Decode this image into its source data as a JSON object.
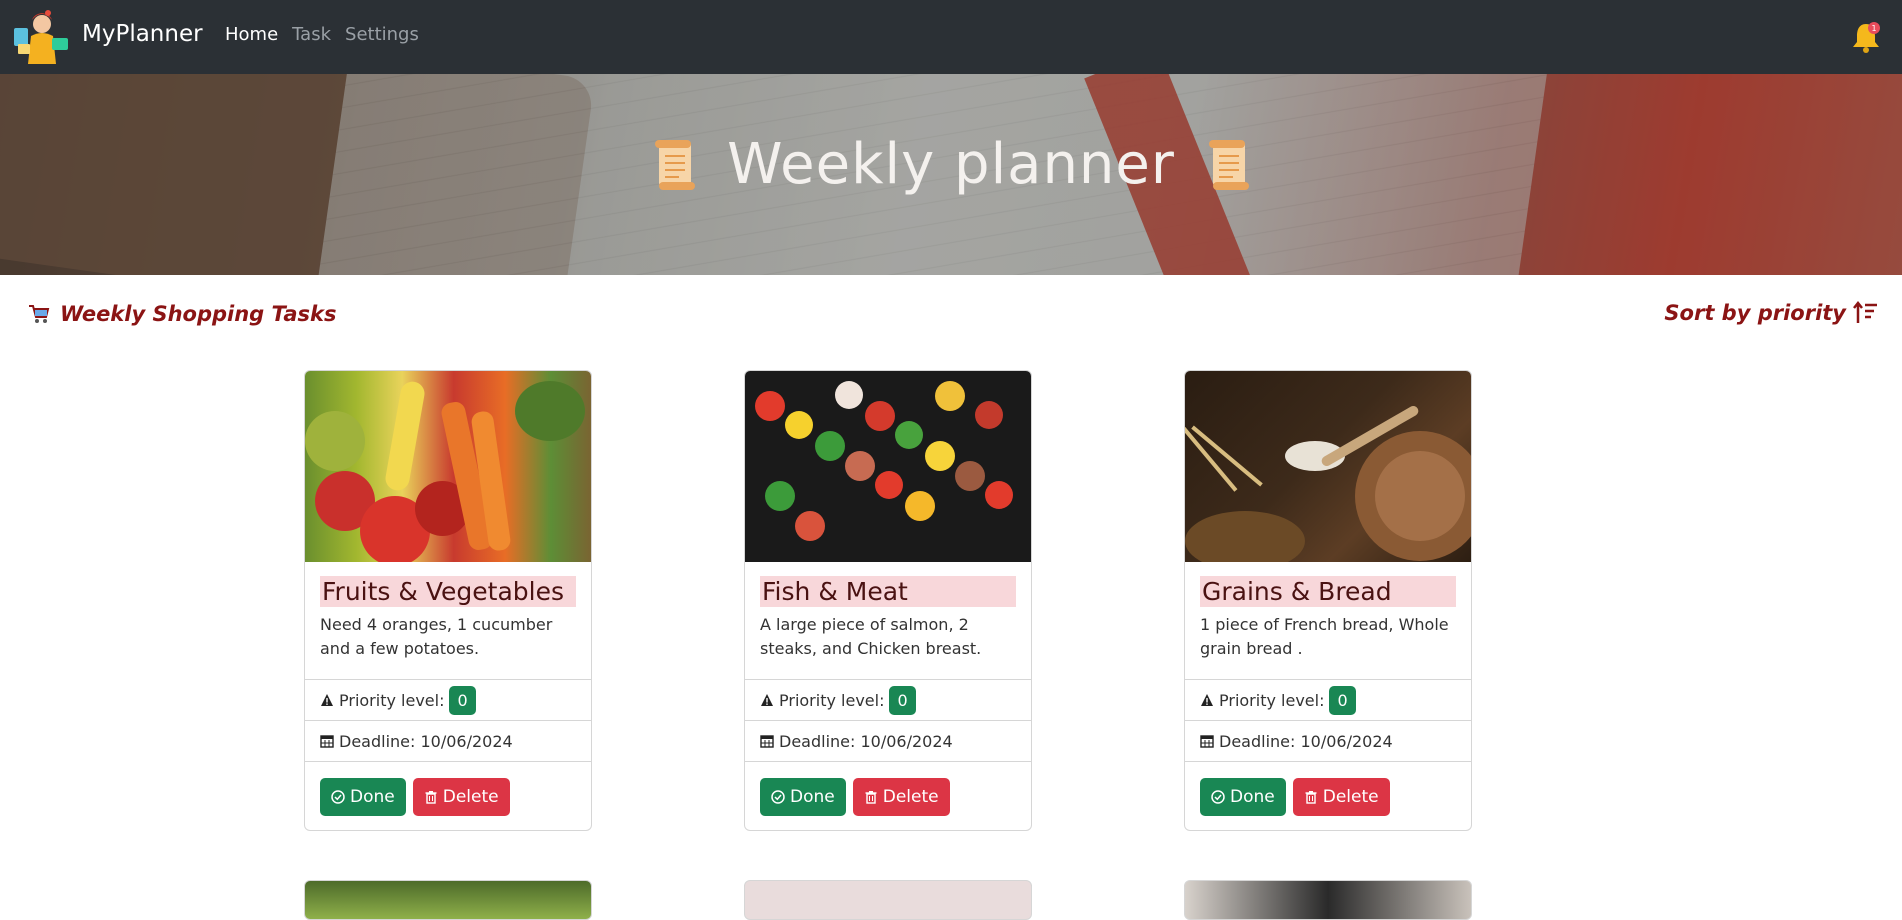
{
  "navbar": {
    "brand": "MyPlanner",
    "links": [
      {
        "label": "Home",
        "active": true
      },
      {
        "label": "Task",
        "active": false
      },
      {
        "label": "Settings",
        "active": false
      }
    ],
    "notification_count": "1",
    "icons": {
      "logo": "shopper-girl-logo",
      "bell": "bell-icon"
    }
  },
  "hero": {
    "title": "Weekly planner",
    "icons": [
      "scroll-icon",
      "scroll-icon"
    ]
  },
  "section": {
    "title": "Weekly Shopping Tasks",
    "sort_label": "Sort by priority",
    "icons": {
      "cart": "cart-icon",
      "sort": "sort-up-icon"
    }
  },
  "cards": [
    {
      "title": "Fruits & Vegetables",
      "description": "Need 4 oranges, 1 cucumber and a few potatoes.",
      "priority_label": "Priority level:",
      "priority": "0",
      "deadline": "Deadline: 10/06/2024",
      "done_label": "Done",
      "delete_label": "Delete",
      "image": "fruits-vegetables-photo"
    },
    {
      "title": "Fish & Meat",
      "description": "A large piece of salmon, 2 steaks, and Chicken breast.",
      "priority_label": "Priority level:",
      "priority": "0",
      "deadline": "Deadline: 10/06/2024",
      "done_label": "Done",
      "delete_label": "Delete",
      "image": "kebab-skewers-photo"
    },
    {
      "title": "Grains & Bread",
      "description": "1 piece of French bread, Whole grain bread .",
      "priority_label": "Priority level:",
      "priority": "0",
      "deadline": "Deadline: 10/06/2024",
      "done_label": "Done",
      "delete_label": "Delete",
      "image": "grains-bread-photo"
    }
  ],
  "colors": {
    "navbar": "#2b3035",
    "accent": "#8b1414",
    "title_highlight": "#f8d7da",
    "success": "#198754",
    "danger": "#dc3545"
  }
}
